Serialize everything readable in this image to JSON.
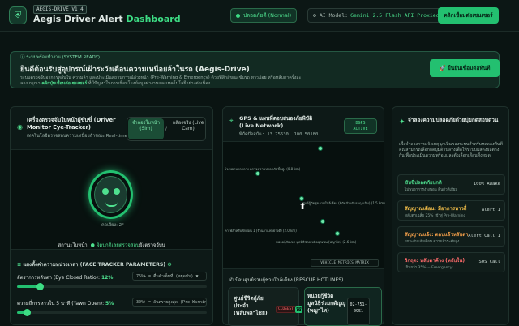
{
  "header": {
    "version_badge": "AEGIS-DRIVE V1.4",
    "title_main": "Aegis Driver Alert",
    "title_accent": "Dashboard",
    "status_pill": "ปลอดภัยดี (Normal)",
    "ai_label": "AI Model:",
    "ai_value": "Gemini 2.5 Flash API Proxied",
    "connect_button": "คลิกเชื่อมต่อเซนเซอร์"
  },
  "banner": {
    "system_tag": "ระบบพร้อมทำงาน (SYSTEM READY)",
    "heading": "ยินดีต้อนรับสู่อุปกรณ์เฝ้าระวังเตือนความเหนื่อยล้าในรถ (Aegis-Drive)",
    "desc_line1": "ระบบตรวจจับอาการหลับใน ความล้า และประเมินสถานการณ์ล่วงหน้า (Pre-Warning & Emergency) ด้วยฟิสิกส์ขณะขับรถ หาวบ่อย หรือหลับตาครั้งละ",
    "desc_line2_a": "ลอง กรุณา",
    "desc_line2_link": "คลิกปุ่มเชื่อมต่อเซนเซอร์",
    "desc_line2_b": "ที่มีปัญหาในการเชื่อมโยงข้อมูลทำงานและเทคโนโลยีอย่างต่อเนื่อง",
    "start_button": "ยืนยันเชื่อมต่อทันที"
  },
  "monitor": {
    "title": "เครื่องตรวจจับใบหน้าผู้ขับขี่ (Driver Monitor Eye-Tracker)",
    "subtitle": "เทคโนโลยีตรวจสอบความเหนื่อยล้าขณะ Real-time",
    "mode_sim": "จำลองใบหน้า (Sim)",
    "mode_sep": "/",
    "mode_live": "กล้องจริง (Live Cam)",
    "tilt": "คอเอียง: 2°",
    "status_prefix": "สถานะใบหน้า:",
    "status_value": "ผิดปกติเลยตรวจสอบ",
    "status_suffix": "ยังตรวจจับบ",
    "params_title_a": "แผงตั้งค่าความหน่วงเวลา",
    "params_title_b": "(FACE TRACKER PARAMETERS)",
    "eye_label": "อัตราการหลับตา (Eye Closed Ratio):",
    "eye_value": "12%",
    "eye_box": "75%+ = ตื่นตัวเต็มที่ (หยุดขับ) ▼",
    "eye_level": 0.12,
    "yawn_label": "ความถี่การหาวใน 5 นาที (Yawn Open):",
    "yawn_value": "5%",
    "yawn_box": "30%+ = อันตรายสูงสุด (Pre-Warning) ▼",
    "yawn_level": 0.05
  },
  "gps": {
    "title": "GPS & แผนที่ตอบสนองภัยพิบัติ (Live Network)",
    "coords": "พิกัดปัจจุบัน: 13.75630, 100.50180",
    "badge_line1": "DGPS",
    "badge_line2": "ACTIVE",
    "pois": [
      {
        "name": "โรงพยาบาลกลาง ตรวจความปลอดภัยขั้นสูง (0.8 km)"
      },
      {
        "name": "ปั๊มน้ำมันแกะ สถานีเติมพลังงาน (1.2 km)"
      },
      {
        "name": "ศูนย์กู้ภัยสุขภาพใกล้เคียง (พิกัดสำหรับรถฉุกเฉิน) (1.5 km)"
      },
      {
        "name": "คาเฟ่สำหรับพักผ่อน 1 (ร้านกาแฟอย่างดี) (2.0 km)"
      },
      {
        "name": "หน่วยกู้ภัยเขต มูลนิธิช่วยเหลือฉุกเฉิน (พญาไท) (2.6 km)"
      }
    ],
    "metrics_button": "VEHICLE METRICS MATRIX",
    "rescue_title": "ป้อนศูนย์รวมผู้ช่วยใกล้เคียง (RESCUE HOTLINES)",
    "rescue1_name": "ศูนย์ชีวิตกู้ภัยประจำ (พลับพลาไชย)",
    "rescue1_tag": "CLOSEST",
    "rescue2_name": "หน่วยกู้ชีวิต มูลนิธิร่วมกตัญญู (พญาไท)",
    "rescue2_phone": "02-751-0951",
    "rescue2_icon": "☎"
  },
  "simulate": {
    "title": "จำลองความปลอดภัยด้วยปุ่มกดสอบด่วน",
    "desc": "เพื่อจำลองการแจ้งเหตุฉุกเฉินของระบบสำหรับทดลองทันที คุณสามารถเลือกกดปุ่มด้านล่างเพื่อให้ระบบแสดงผลต่างกันเพื่อประเมินความพร้อมและตัวเลือกเตือนทั้งหมด",
    "items": [
      {
        "title": "ขับขี่ปลอดภัยปกติ",
        "sub": "ไม่พบอาการง่วงนอน ตื่นตัวดีเยี่ยม",
        "right": "100% Awake",
        "color": "#4fe08f"
      },
      {
        "title": "สัญญาณเตือน: มีอาการหาวถี่",
        "sub": "หลับตาเฉลี่ย 25% เข้าสู่ Pre-Warning",
        "right": "Alert 1",
        "color": "#f5c04a"
      },
      {
        "title": "สัญญาณแจ้ง: ตอบแล้วหลับตา",
        "sub": "ยกระดับแจ้งเตือน ความล้าระดับสูง",
        "right": "Alert Call 1",
        "color": "#f5a04a"
      },
      {
        "title": "วิกฤต: หลับตาค้าง (หลับใน)",
        "sub": "เกินกว่า 35% = Emergency",
        "right": "SOS Call",
        "color": "#ff6b6b"
      }
    ]
  }
}
